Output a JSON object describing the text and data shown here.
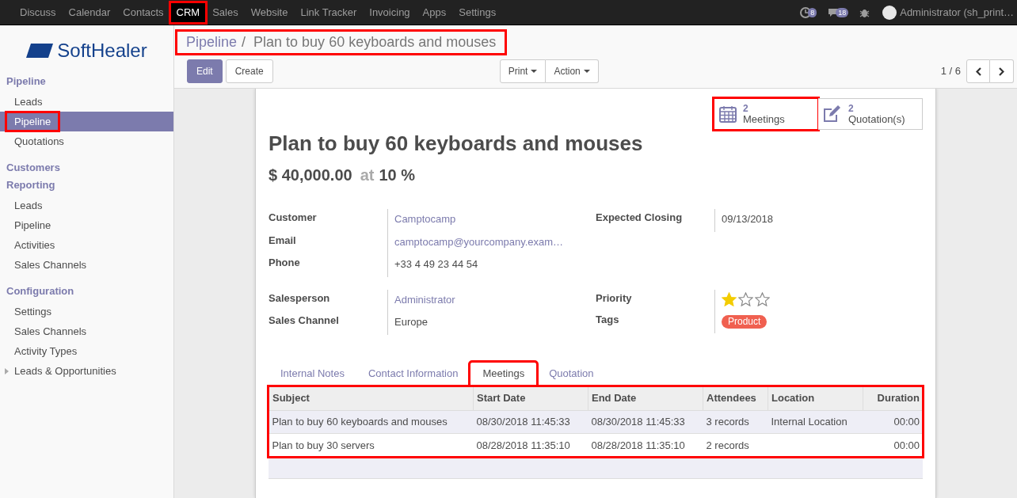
{
  "top_menu": [
    {
      "label": "Discuss",
      "selected": false,
      "highlighted": false
    },
    {
      "label": "Calendar",
      "selected": false,
      "highlighted": false
    },
    {
      "label": "Contacts",
      "selected": false,
      "highlighted": false
    },
    {
      "label": "CRM",
      "selected": true,
      "highlighted": true
    },
    {
      "label": "Sales",
      "selected": false,
      "highlighted": false
    },
    {
      "label": "Website",
      "selected": false,
      "highlighted": false
    },
    {
      "label": "Link Tracker",
      "selected": false,
      "highlighted": false
    },
    {
      "label": "Invoicing",
      "selected": false,
      "highlighted": false
    },
    {
      "label": "Apps",
      "selected": false,
      "highlighted": false
    },
    {
      "label": "Settings",
      "selected": false,
      "highlighted": false
    }
  ],
  "systray": {
    "activities_count": "8",
    "messages_count": "18",
    "user": "Administrator (sh_print…"
  },
  "logo_text": "SoftHealer",
  "sidebar": [
    {
      "kind": "header",
      "label": "Pipeline"
    },
    {
      "kind": "item",
      "label": "Leads",
      "selected": false,
      "highlighted": false
    },
    {
      "kind": "item",
      "label": "Pipeline",
      "selected": true,
      "highlighted": true
    },
    {
      "kind": "item",
      "label": "Quotations",
      "selected": false,
      "highlighted": false
    },
    {
      "kind": "header",
      "label": "Customers"
    },
    {
      "kind": "header",
      "label": "Reporting"
    },
    {
      "kind": "item",
      "label": "Leads",
      "selected": false,
      "highlighted": false
    },
    {
      "kind": "item",
      "label": "Pipeline",
      "selected": false,
      "highlighted": false
    },
    {
      "kind": "item",
      "label": "Activities",
      "selected": false,
      "highlighted": false
    },
    {
      "kind": "item",
      "label": "Sales Channels",
      "selected": false,
      "highlighted": false
    },
    {
      "kind": "header",
      "label": "Configuration"
    },
    {
      "kind": "item",
      "label": "Settings",
      "selected": false,
      "highlighted": false
    },
    {
      "kind": "item",
      "label": "Sales Channels",
      "selected": false,
      "highlighted": false
    },
    {
      "kind": "item",
      "label": "Activity Types",
      "selected": false,
      "highlighted": false
    },
    {
      "kind": "folder",
      "label": "Leads & Opportunities",
      "expanded": false
    }
  ],
  "breadcrumb": {
    "parent": "Pipeline",
    "separator": "/",
    "current": "Plan to buy 60 keyboards and mouses",
    "highlighted": true
  },
  "buttons": [
    {
      "kind": "primary",
      "label": "Edit"
    },
    {
      "kind": "default",
      "label": "Create"
    }
  ],
  "dropdowns": [
    "Print",
    "Action"
  ],
  "pager": "1 / 6",
  "stat_buttons": [
    {
      "count": "2",
      "label": "Meetings",
      "highlighted": true
    },
    {
      "count": "2",
      "label": "Quotation(s)",
      "highlighted": false
    }
  ],
  "title": "Plan to buy 60 keyboards and mouses",
  "revenue": {
    "amount": "$ 40,000.00",
    "at": "at",
    "probability": "10 %"
  },
  "groups": [
    {
      "left": [
        {
          "label": "Customer",
          "value": "Camptocamp",
          "kind": "link"
        },
        {
          "label": "Email",
          "value": "camptocamp@yourcompany.exam…",
          "kind": "link"
        },
        {
          "label": "Phone",
          "value": "+33 4 49 23 44 54",
          "kind": "text"
        }
      ],
      "right": [
        {
          "label": "Expected Closing",
          "value": "09/13/2018",
          "kind": "text"
        }
      ]
    },
    {
      "left": [
        {
          "label": "Salesperson",
          "value": "Administrator",
          "kind": "link"
        },
        {
          "label": "Sales Channel",
          "value": "Europe",
          "kind": "text"
        }
      ],
      "right": [
        {
          "label": "Priority",
          "kind": "stars",
          "stars": 1
        },
        {
          "label": "Tags",
          "kind": "tags",
          "tags": [
            {
              "label": "Product",
              "color": "#f06050"
            }
          ]
        }
      ]
    }
  ],
  "tabs": [
    {
      "label": "Internal Notes",
      "selected": false,
      "highlighted": false
    },
    {
      "label": "Contact Information",
      "selected": false,
      "highlighted": false
    },
    {
      "label": "Meetings",
      "selected": true,
      "highlighted": true
    },
    {
      "label": "Quotation",
      "selected": false,
      "highlighted": false
    }
  ],
  "meetings_table": {
    "highlighted": true,
    "columns": [
      "Subject",
      "Start Date",
      "End Date",
      "Attendees",
      "Location",
      "Duration"
    ],
    "rows": [
      {
        "selected": true,
        "cells": [
          "Plan to buy 60 keyboards and mouses",
          "08/30/2018 11:45:33",
          "08/30/2018 11:45:33",
          "3 records",
          "Internal Location",
          "00:00"
        ]
      },
      {
        "selected": false,
        "cells": [
          "Plan to buy 30 servers",
          "08/28/2018 11:35:10",
          "08/28/2018 11:35:10",
          "2 records",
          "",
          "00:00"
        ]
      }
    ]
  }
}
